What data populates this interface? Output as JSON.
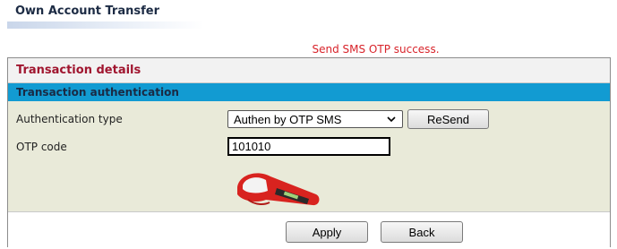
{
  "header": {
    "title": "Own Account Transfer"
  },
  "status": {
    "message": "Send SMS OTP success."
  },
  "transaction": {
    "section_title": "Transaction details"
  },
  "auth": {
    "section_title": "Transaction authentication",
    "type_label": "Authentication type",
    "type_value": "Authen by OTP SMS",
    "resend_label": "ReSend",
    "otp_label": "OTP code",
    "otp_value": "101010",
    "token_icon": "otp-token-device-icon"
  },
  "actions": {
    "apply_label": "Apply",
    "back_label": "Back"
  },
  "colors": {
    "title": "#1c2b44",
    "status": "#d8232a",
    "section_header_text": "#a0152f",
    "auth_bar": "#129bd2",
    "auth_body": "#e9ead9"
  }
}
